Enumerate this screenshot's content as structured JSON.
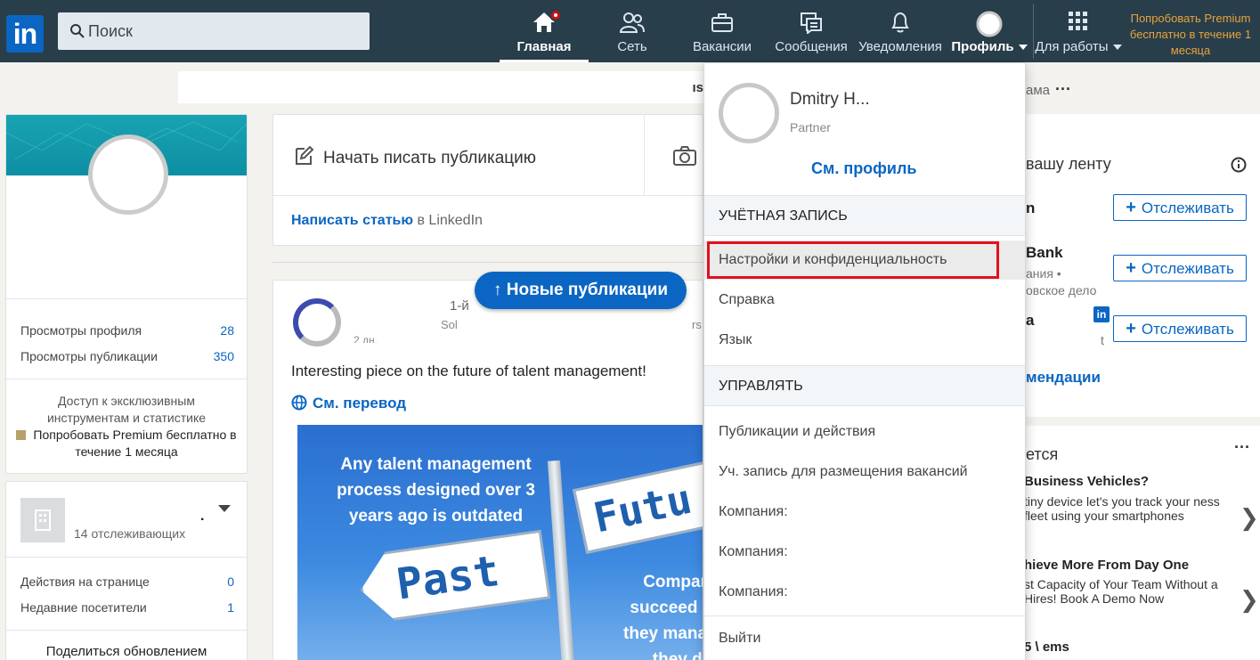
{
  "nav": {
    "logo": "in",
    "search_placeholder": "Поиск",
    "items": [
      {
        "label": "Главная",
        "icon": "home-icon"
      },
      {
        "label": "Сеть",
        "icon": "people-icon"
      },
      {
        "label": "Вакансии",
        "icon": "briefcase-icon"
      },
      {
        "label": "Сообщения",
        "icon": "messages-icon"
      },
      {
        "label": "Уведомления",
        "icon": "bell-icon"
      },
      {
        "label": "Профиль",
        "icon": "avatar-icon"
      },
      {
        "label": "Для работы",
        "icon": "grid-icon"
      }
    ],
    "premium": "Попробовать Premium бесплатно в течение 1 месяца"
  },
  "ad_strip": {
    "tail": "ıs",
    "right_tail": "ама",
    "right_dots": "···"
  },
  "profile_card": {
    "stats": [
      {
        "label": "Просмотры профиля",
        "value": "28"
      },
      {
        "label": "Просмотры публикации",
        "value": "350"
      }
    ],
    "premium_text": "Доступ к эксклюзивным инструментам и статистике",
    "premium_link": "Попробовать Premium бесплатно в течение 1 месяца"
  },
  "company_card": {
    "name_fragment": ".",
    "followers": "14 отслеживающих",
    "stats": [
      {
        "label": "Действия на странице",
        "value": "0"
      },
      {
        "label": "Недавние посетители",
        "value": "1"
      }
    ],
    "share_update": "Поделиться обновлением"
  },
  "share_box": {
    "start_post": "Начать писать публикацию",
    "write_article_link": "Написать статью",
    "write_article_suffix": "в LinkedIn"
  },
  "new_posts_button": "↑ Новые публикации",
  "post": {
    "degree": "1-й",
    "sub1": "Sol",
    "sub2": "2 дн.",
    "sub_r": "rs",
    "text": "Interesting piece on the future of talent management!",
    "translate": "См. перевод",
    "image_headline": "Any talent management process designed over 3 years ago is outdated",
    "sign_future": "Futu",
    "sign_past": "Past",
    "side_text": "Compar succeed i they mana they di"
  },
  "right_rail": {
    "title": "вашу ленту",
    "follow_label": "Отслеживать",
    "entries": [
      {
        "name": "n",
        "sub": ""
      },
      {
        "name": "Bank",
        "sub": "ания • овское дело"
      },
      {
        "name": "a",
        "sub": "t"
      }
    ],
    "recommendations": "мендации"
  },
  "right_rail2": {
    "title": "ется",
    "dots": "···",
    "news": [
      {
        "title": "Business Vehicles?",
        "sub": "tiny device let's you track your ness fleet using your smartphones"
      },
      {
        "title": "hieve More From Day One",
        "sub": "st Capacity of Your Team Without a Hires! Book A Demo Now"
      },
      {
        "title": "5 \\ ems",
        "sub": ""
      }
    ],
    "chevron": "❯"
  },
  "dropdown": {
    "name": "Dmitry H...",
    "sub": "Partner",
    "see_profile": "См. профиль",
    "section_account": "УЧЁТНАЯ ЗАПИСЬ",
    "account_items": [
      "Настройки и конфиденциальность",
      "Справка",
      "Язык"
    ],
    "section_manage": "УПРАВЛЯТЬ",
    "manage_items": [
      "Публикации и действия",
      "Уч. запись для размещения вакансий",
      "Компания:",
      "Компания:",
      "Компания:"
    ],
    "logout": "Выйти"
  },
  "colors": {
    "nav_bg": "#283e4a",
    "link": "#0a66c2",
    "premium": "#e7a33e",
    "highlight": "#e3101b"
  }
}
